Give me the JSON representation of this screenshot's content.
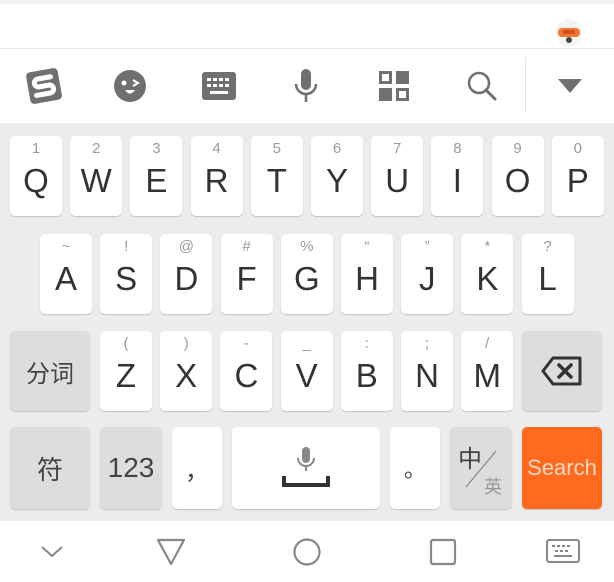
{
  "input_bar": {
    "mascot_icon": "sogou-mascot-icon"
  },
  "toolbar": {
    "items": [
      {
        "name": "sogou-logo",
        "icon": "sogou-s-icon"
      },
      {
        "name": "emoji",
        "icon": "wink-face-icon"
      },
      {
        "name": "keyboard",
        "icon": "keyboard-icon"
      },
      {
        "name": "voice",
        "icon": "microphone-icon"
      },
      {
        "name": "toolbox",
        "icon": "grid-icon"
      },
      {
        "name": "search",
        "icon": "search-icon"
      },
      {
        "name": "collapse",
        "icon": "triangle-down-icon"
      }
    ]
  },
  "keyboard": {
    "row1": [
      {
        "main": "Q",
        "sub": "1"
      },
      {
        "main": "W",
        "sub": "2"
      },
      {
        "main": "E",
        "sub": "3"
      },
      {
        "main": "R",
        "sub": "4"
      },
      {
        "main": "T",
        "sub": "5"
      },
      {
        "main": "Y",
        "sub": "6"
      },
      {
        "main": "U",
        "sub": "7"
      },
      {
        "main": "I",
        "sub": "8"
      },
      {
        "main": "O",
        "sub": "9"
      },
      {
        "main": "P",
        "sub": "0"
      }
    ],
    "row2": [
      {
        "main": "A",
        "sub": "~"
      },
      {
        "main": "S",
        "sub": "!"
      },
      {
        "main": "D",
        "sub": "@"
      },
      {
        "main": "F",
        "sub": "#"
      },
      {
        "main": "G",
        "sub": "%"
      },
      {
        "main": "H",
        "sub": "“"
      },
      {
        "main": "J",
        "sub": "”"
      },
      {
        "main": "K",
        "sub": "*"
      },
      {
        "main": "L",
        "sub": "?"
      }
    ],
    "row3": {
      "left": "分词",
      "keys": [
        {
          "main": "Z",
          "sub": "("
        },
        {
          "main": "X",
          "sub": ")"
        },
        {
          "main": "C",
          "sub": "-"
        },
        {
          "main": "V",
          "sub": "_"
        },
        {
          "main": "B",
          "sub": ":"
        },
        {
          "main": "N",
          "sub": ";"
        },
        {
          "main": "M",
          "sub": "/"
        }
      ],
      "backspace_icon": "backspace-icon"
    },
    "row4": {
      "symbols": "符",
      "numbers": "123",
      "comma": "，",
      "space_icon": "microphone-space-icon",
      "period": "。",
      "lang_primary": "中",
      "lang_secondary": "英",
      "enter": "Search"
    },
    "accent_color": "#ff6a1e"
  },
  "navbar": {
    "items": [
      {
        "name": "hide-keyboard",
        "icon": "chevron-down-icon"
      },
      {
        "name": "back",
        "icon": "triangle-back-icon"
      },
      {
        "name": "home",
        "icon": "circle-home-icon"
      },
      {
        "name": "recents",
        "icon": "square-recents-icon"
      },
      {
        "name": "switch-ime",
        "icon": "keyboard-switch-icon"
      }
    ]
  }
}
